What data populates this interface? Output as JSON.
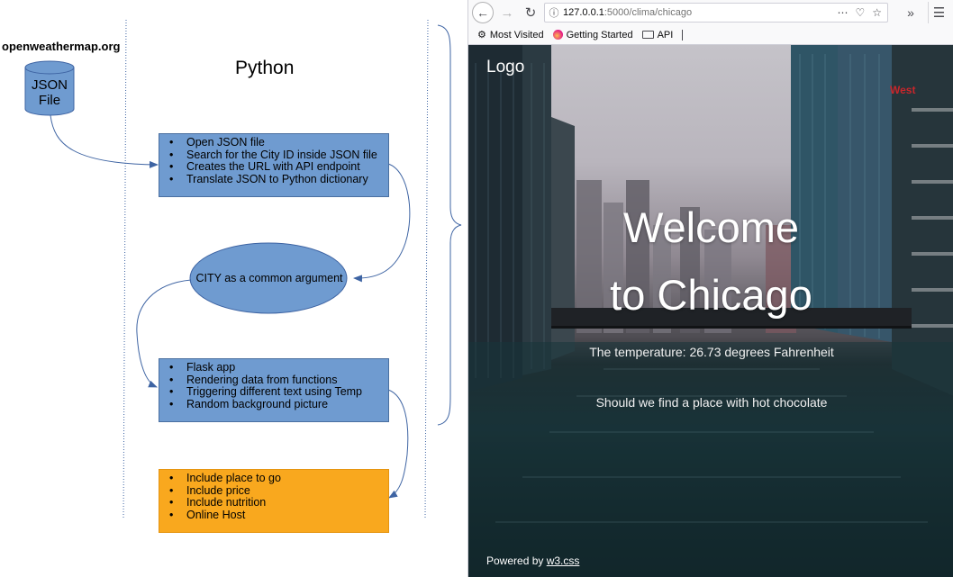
{
  "diagram": {
    "source_label": "openweathermap.org",
    "section_title": "Python",
    "db_label": "JSON\nFile",
    "box1": [
      "Open JSON file",
      "Search for the City ID inside JSON file",
      "Creates the URL with API endpoint",
      "Translate JSON to Python dictionary"
    ],
    "ellipse_label": "CITY as a common argument",
    "box2": [
      "Flask app",
      "Rendering data from functions",
      "Triggering different text using Temp",
      "Random background picture"
    ],
    "box3": [
      "Include place to go",
      "Include price",
      "Include nutrition",
      "Online Host"
    ],
    "colors": {
      "blue": "#6f9bd0",
      "orange": "#f9a81e"
    }
  },
  "browser": {
    "url_host": "127.0.0.1",
    "url_path": ":5000/clima/chicago",
    "icons": {
      "back": "back-arrow-icon",
      "forward": "forward-arrow-icon",
      "reload": "reload-icon",
      "info": "info-icon",
      "page_actions": "ellipsis-icon",
      "pocket": "pocket-icon",
      "bookmark": "star-icon",
      "overflow": "double-chevron-icon",
      "menu": "hamburger-icon"
    },
    "bookmarks": [
      {
        "label": "Most Visited",
        "icon": "gear-icon"
      },
      {
        "label": "Getting Started",
        "icon": "firefox-icon"
      },
      {
        "label": "API",
        "icon": "folder-icon"
      }
    ]
  },
  "page": {
    "logo": "Logo",
    "title_line1": "Welcome",
    "title_line2": "to Chicago",
    "temperature": "The temperature: 26.73 degrees Fahrenheit",
    "message": "Should we find a place with hot chocolate",
    "footer_prefix": "Powered by ",
    "footer_link": "w3.css"
  }
}
